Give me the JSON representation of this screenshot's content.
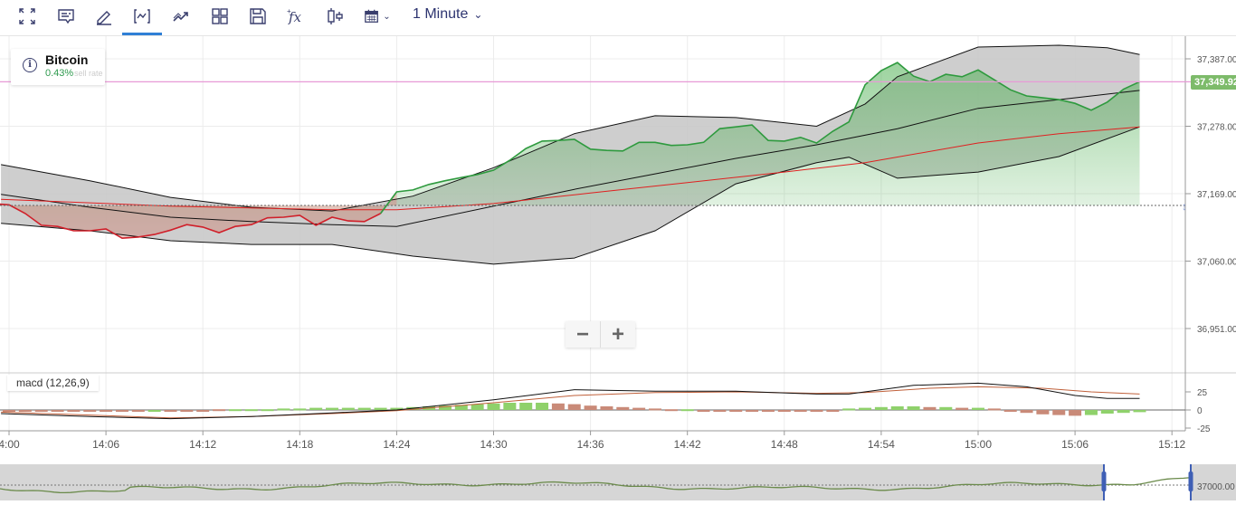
{
  "toolbar": {
    "buttons": [
      {
        "name": "fullscreen-icon"
      },
      {
        "name": "chart-comment-icon"
      },
      {
        "name": "draw-pencil-icon"
      },
      {
        "name": "chart-type-icon",
        "active": true
      },
      {
        "name": "trend-icon"
      },
      {
        "name": "layout-grid-icon"
      },
      {
        "name": "save-icon"
      },
      {
        "name": "function-fx-icon"
      },
      {
        "name": "candlestick-icon"
      },
      {
        "name": "calendar-icon"
      }
    ],
    "interval": "1 Minute"
  },
  "legend": {
    "symbol": "Bitcoin",
    "change": "0.43%",
    "sublabel": "sell rate"
  },
  "current_price": "37,349.92",
  "zoom": {
    "minus": "−",
    "plus": "+"
  },
  "macd_label": "macd (12,26,9)",
  "navigator_label": "37000.00",
  "colors": {
    "up": "#2e9a3e",
    "down": "#d0202a",
    "price_line": "#e79ad6",
    "band": "#c9c9c9",
    "ma": "#e02020",
    "tag": "#7dbb6a",
    "accent": "#2f7fd6"
  },
  "chart_data": {
    "type": "line",
    "x_unit": "minutes after 14:00",
    "xticks": [
      {
        "m": 0,
        "label": "4:00"
      },
      {
        "m": 6,
        "label": "14:06"
      },
      {
        "m": 12,
        "label": "14:12"
      },
      {
        "m": 18,
        "label": "14:18"
      },
      {
        "m": 24,
        "label": "14:24"
      },
      {
        "m": 30,
        "label": "14:30"
      },
      {
        "m": 36,
        "label": "14:36"
      },
      {
        "m": 42,
        "label": "14:42"
      },
      {
        "m": 48,
        "label": "14:48"
      },
      {
        "m": 54,
        "label": "14:54"
      },
      {
        "m": 60,
        "label": "15:00"
      },
      {
        "m": 66,
        "label": "15:06"
      },
      {
        "m": 72,
        "label": "15:12"
      }
    ],
    "yticks": [
      {
        "v": 37387,
        "label": "37,387.00"
      },
      {
        "v": 37278,
        "label": "37,278.00"
      },
      {
        "v": 37169,
        "label": "37,169.00"
      },
      {
        "v": 37060,
        "label": "37,060.00"
      },
      {
        "v": 36951,
        "label": "36,951.00"
      }
    ],
    "baseline": 37150,
    "last_price": 37349.92,
    "price_start_minute": -1,
    "price": [
      37153,
      37151,
      37137,
      37118,
      37116,
      37109,
      37109,
      37112,
      37097,
      37099,
      37103,
      37110,
      37119,
      37115,
      37106,
      37116,
      37119,
      37130,
      37131,
      37134,
      37118,
      37131,
      37125,
      37124,
      37137,
      37172,
      37175,
      37184,
      37190,
      37195,
      37200,
      37207,
      37223,
      37242,
      37254,
      37255,
      37257,
      37241,
      37239,
      37238,
      37252,
      37252,
      37247,
      37248,
      37252,
      37274,
      37277,
      37280,
      37255,
      37254,
      37260,
      37251,
      37270,
      37285,
      37345,
      37368,
      37381,
      37359,
      37350,
      37362,
      37358,
      37369,
      37353,
      37337,
      37327,
      37324,
      37321,
      37315,
      37304,
      37317,
      37338,
      37349.92
    ],
    "bollinger_upper": [
      [
        -0.5,
        37216
      ],
      [
        5,
        37190
      ],
      [
        10,
        37163
      ],
      [
        15,
        37147
      ],
      [
        20,
        37141
      ],
      [
        25,
        37165
      ],
      [
        30,
        37211
      ],
      [
        35,
        37266
      ],
      [
        40,
        37295
      ],
      [
        45,
        37292
      ],
      [
        50,
        37278
      ],
      [
        53,
        37314
      ],
      [
        55,
        37358
      ],
      [
        60,
        37406
      ],
      [
        65,
        37409
      ],
      [
        68,
        37405
      ],
      [
        70,
        37394
      ]
    ],
    "bollinger_lower": [
      [
        -0.5,
        37121
      ],
      [
        5,
        37109
      ],
      [
        10,
        37093
      ],
      [
        15,
        37087
      ],
      [
        20,
        37087
      ],
      [
        25,
        37068
      ],
      [
        30,
        37055
      ],
      [
        35,
        37065
      ],
      [
        40,
        37109
      ],
      [
        45,
        37185
      ],
      [
        50,
        37219
      ],
      [
        52,
        37228
      ],
      [
        55,
        37194
      ],
      [
        60,
        37204
      ],
      [
        65,
        37229
      ],
      [
        70,
        37277
      ]
    ],
    "bollinger_middle": [
      [
        -0.5,
        37168
      ],
      [
        5,
        37147
      ],
      [
        10,
        37131
      ],
      [
        15,
        37124
      ],
      [
        20,
        37119
      ],
      [
        24,
        37116
      ],
      [
        30,
        37149
      ],
      [
        35,
        37176
      ],
      [
        40,
        37201
      ],
      [
        45,
        37226
      ],
      [
        50,
        37248
      ],
      [
        55,
        37274
      ],
      [
        60,
        37307
      ],
      [
        65,
        37321
      ],
      [
        70,
        37336
      ]
    ],
    "moving_average": [
      [
        -0.5,
        37160
      ],
      [
        10,
        37149
      ],
      [
        20,
        37143
      ],
      [
        24,
        37143
      ],
      [
        30,
        37153
      ],
      [
        36,
        37170
      ],
      [
        42,
        37187
      ],
      [
        48,
        37204
      ],
      [
        53,
        37219
      ],
      [
        60,
        37251
      ],
      [
        65,
        37266
      ],
      [
        70,
        37277
      ]
    ],
    "macd": {
      "yticks": [
        {
          "v": 25,
          "label": "25"
        },
        {
          "v": 0,
          "label": "0"
        },
        {
          "v": -25,
          "label": "-25"
        }
      ],
      "macd_line": [
        [
          -0.5,
          -5
        ],
        [
          5,
          -9
        ],
        [
          10,
          -12
        ],
        [
          15,
          -9
        ],
        [
          20,
          -4
        ],
        [
          24,
          0
        ],
        [
          30,
          14
        ],
        [
          35,
          28
        ],
        [
          40,
          26
        ],
        [
          45,
          26
        ],
        [
          50,
          22
        ],
        [
          52,
          22
        ],
        [
          56,
          34
        ],
        [
          60,
          37
        ],
        [
          63,
          32
        ],
        [
          66,
          20
        ],
        [
          68,
          16
        ],
        [
          70,
          16
        ]
      ],
      "signal_line": [
        [
          -0.5,
          -3
        ],
        [
          5,
          -7
        ],
        [
          10,
          -11
        ],
        [
          15,
          -9
        ],
        [
          20,
          -5
        ],
        [
          24,
          -1
        ],
        [
          30,
          10
        ],
        [
          35,
          20
        ],
        [
          40,
          24
        ],
        [
          45,
          25
        ],
        [
          50,
          23
        ],
        [
          53,
          24
        ],
        [
          57,
          30
        ],
        [
          60,
          32
        ],
        [
          64,
          30
        ],
        [
          67,
          25
        ],
        [
          70,
          22
        ]
      ],
      "histogram": [
        -2,
        -2,
        -2,
        -2,
        -2,
        -2,
        -2,
        -2,
        -2,
        -1.5,
        -1.5,
        -1.5,
        -1.5,
        1,
        1,
        1,
        1,
        2,
        2,
        3,
        3,
        3,
        3,
        3,
        3,
        4,
        5,
        6,
        7,
        8,
        9,
        10,
        10,
        10,
        9,
        8,
        6,
        5,
        4,
        3,
        2,
        1,
        1,
        -1,
        -1,
        -1,
        -1,
        -1,
        -1,
        -1,
        -1,
        -1,
        2,
        3,
        4,
        5,
        5,
        4,
        4,
        3,
        3,
        2,
        -2,
        -4,
        -6,
        -7,
        -8,
        -7,
        -5,
        -4,
        -3
      ],
      "histogram_start_minute": 0
    }
  }
}
